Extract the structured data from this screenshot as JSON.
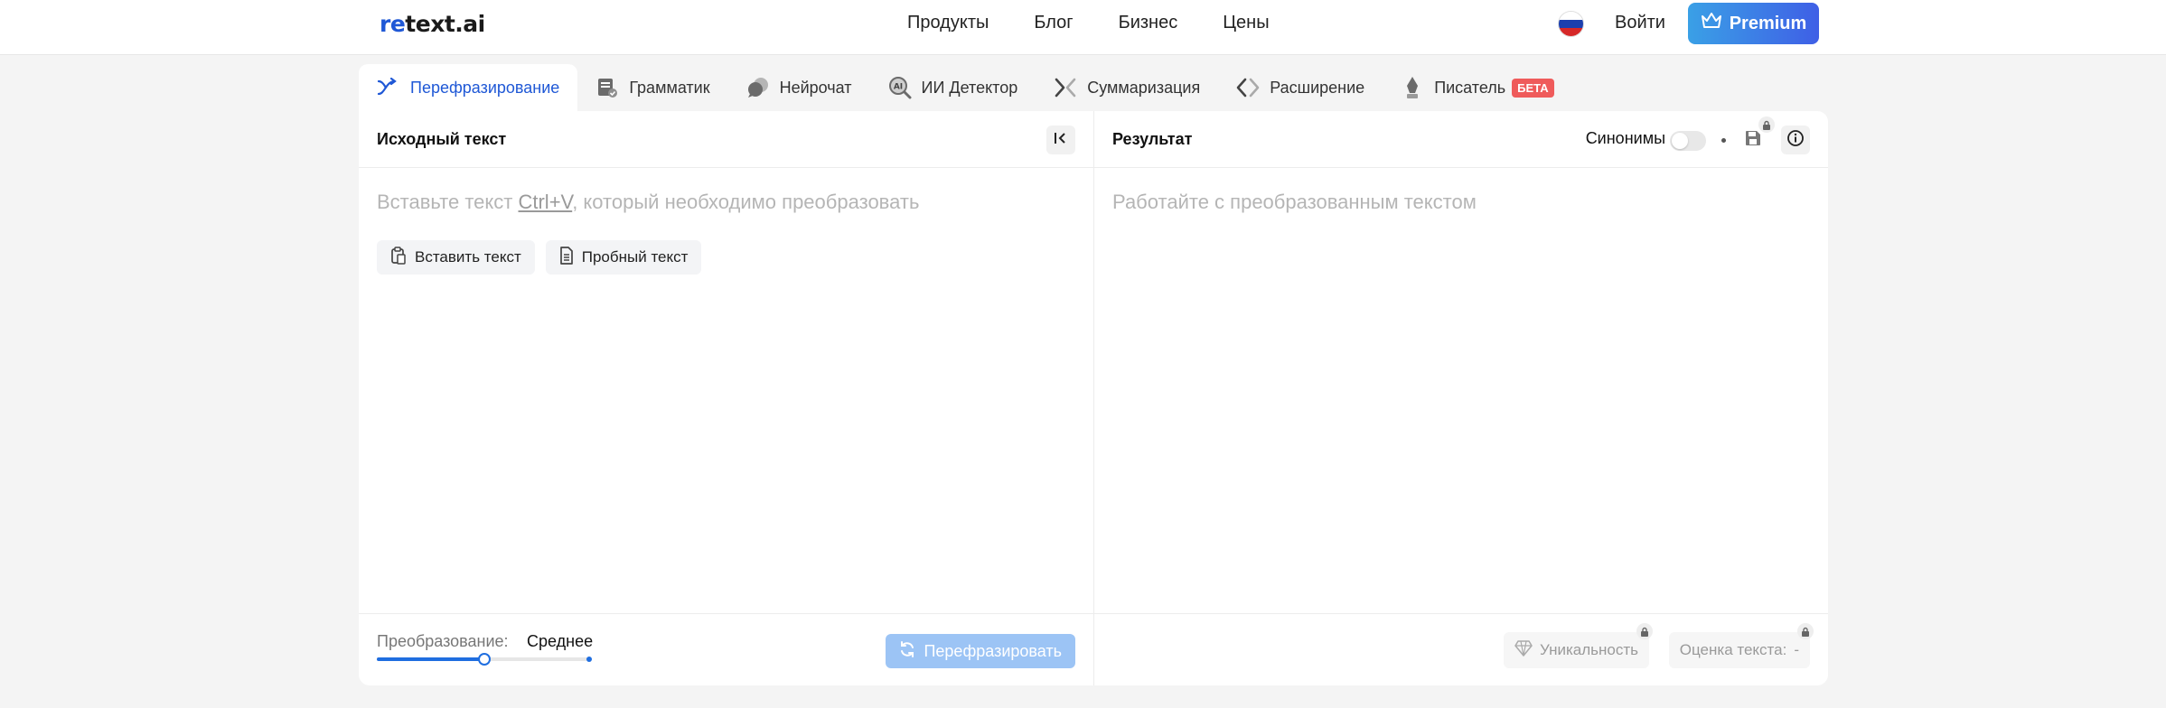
{
  "header": {
    "logo_re": "re",
    "logo_rest": "text.ai",
    "nav": [
      "Продукты",
      "Блог",
      "Бизнес",
      "Цены"
    ],
    "login": "Войти",
    "premium": "Premium"
  },
  "tabs": [
    {
      "label": "Перефразирование",
      "icon": "paraphrase-icon",
      "active": true
    },
    {
      "label": "Грамматик",
      "icon": "grammar-icon"
    },
    {
      "label": "Нейрочат",
      "icon": "chat-icon"
    },
    {
      "label": "ИИ Детектор",
      "icon": "ai-detector-icon"
    },
    {
      "label": "Суммаризация",
      "icon": "summary-icon"
    },
    {
      "label": "Расширение",
      "icon": "expand-icon"
    },
    {
      "label": "Писатель",
      "icon": "writer-icon",
      "badge": "БЕТА"
    }
  ],
  "source": {
    "title": "Исходный текст",
    "placeholder_before": "Вставьте текст ",
    "placeholder_kbd": "Ctrl+V",
    "placeholder_after": ", который необходимо преобразовать",
    "paste_button": "Вставить текст",
    "sample_button": "Пробный текст",
    "conversion_label": "Преобразование:",
    "conversion_value": "Среднее",
    "conversion_level": 0.5,
    "paraphrase_button": "Перефразировать"
  },
  "result": {
    "title": "Результат",
    "placeholder": "Работайте с преобразованным текстом",
    "synonyms_label": "Синонимы",
    "synonyms_on": false,
    "uniqueness": "Уникальность",
    "score_label": "Оценка текста:",
    "score_value": "-"
  },
  "colors": {
    "accent": "#1f58d6",
    "premium_start": "#3aa0e6",
    "premium_end": "#3f5fe6",
    "beta": "#ef5b5b",
    "disabled_button": "#9cc4f5"
  }
}
